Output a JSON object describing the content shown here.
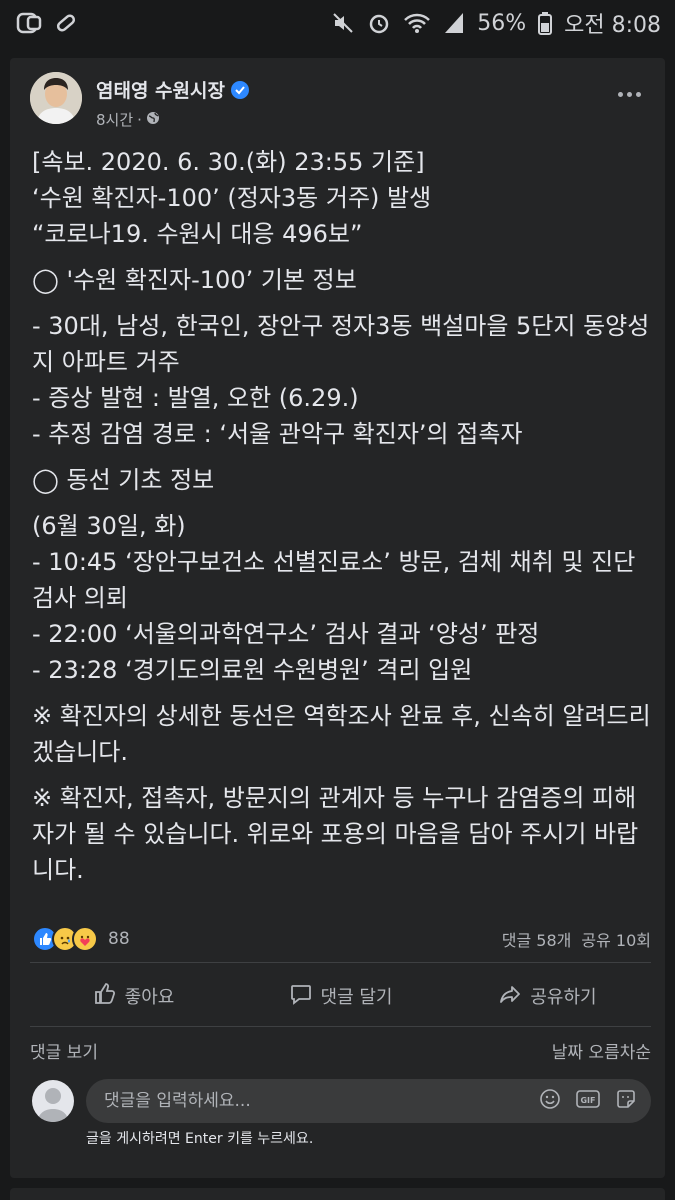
{
  "statusbar": {
    "battery": "56%",
    "time": "오전 8:08"
  },
  "post": {
    "author": "염태영 수원시장",
    "time": "8시간",
    "separator": "·",
    "body": [
      "[속보. 2020. 6. 30.(화) 23:55 기준]",
      "‘수원 확진자-100’ (정자3동 거주) 발생",
      "“코로나19. 수원시 대응 496보”",
      "◯ '수원 확진자-100’ 기본 정보",
      "- 30대, 남성, 한국인, 장안구 정자3동 백설마을 5단지 동양성지 아파트 거주",
      "- 증상 발현 : 발열, 오한 (6.29.)",
      "- 추정 감염 경로 : ‘서울 관악구 확진자’의 접촉자",
      "◯ 동선 기초 정보",
      "(6월 30일, 화)",
      "- 10:45 ‘장안구보건소 선별진료소’ 방문, 검체 채취 및 진단검사 의뢰",
      "- 22:00 ‘서울의과학연구소’ 검사 결과 ‘양성’ 판정",
      "- 23:28 ‘경기도의료원 수원병원’ 격리 입원",
      "※ 확진자의 상세한 동선은 역학조사 완료 후, 신속히 알려드리겠습니다.",
      "※ 확진자, 접촉자, 방문지의 관계자 등 누구나 감염증의 피해자가 될 수 있습니다. 위로와 포용의 마음을 담아 주시기 바랍니다."
    ],
    "reactions_count": "88",
    "comments_count": "댓글 58개",
    "shares_count": "공유 10회"
  },
  "actions": {
    "like": "좋아요",
    "comment": "댓글 달기",
    "share": "공유하기"
  },
  "comments": {
    "view": "댓글 보기",
    "sort": "날짜 오름차순",
    "placeholder": "댓글을 입력하세요...",
    "hint": "글을 게시하려면 Enter 키를 누르세요.",
    "gif_label": "GIF"
  },
  "colors": {
    "background": "#18191a",
    "card": "#242526",
    "text": "#e4e6eb",
    "muted": "#b0b3b8",
    "accent": "#2d88ff"
  }
}
